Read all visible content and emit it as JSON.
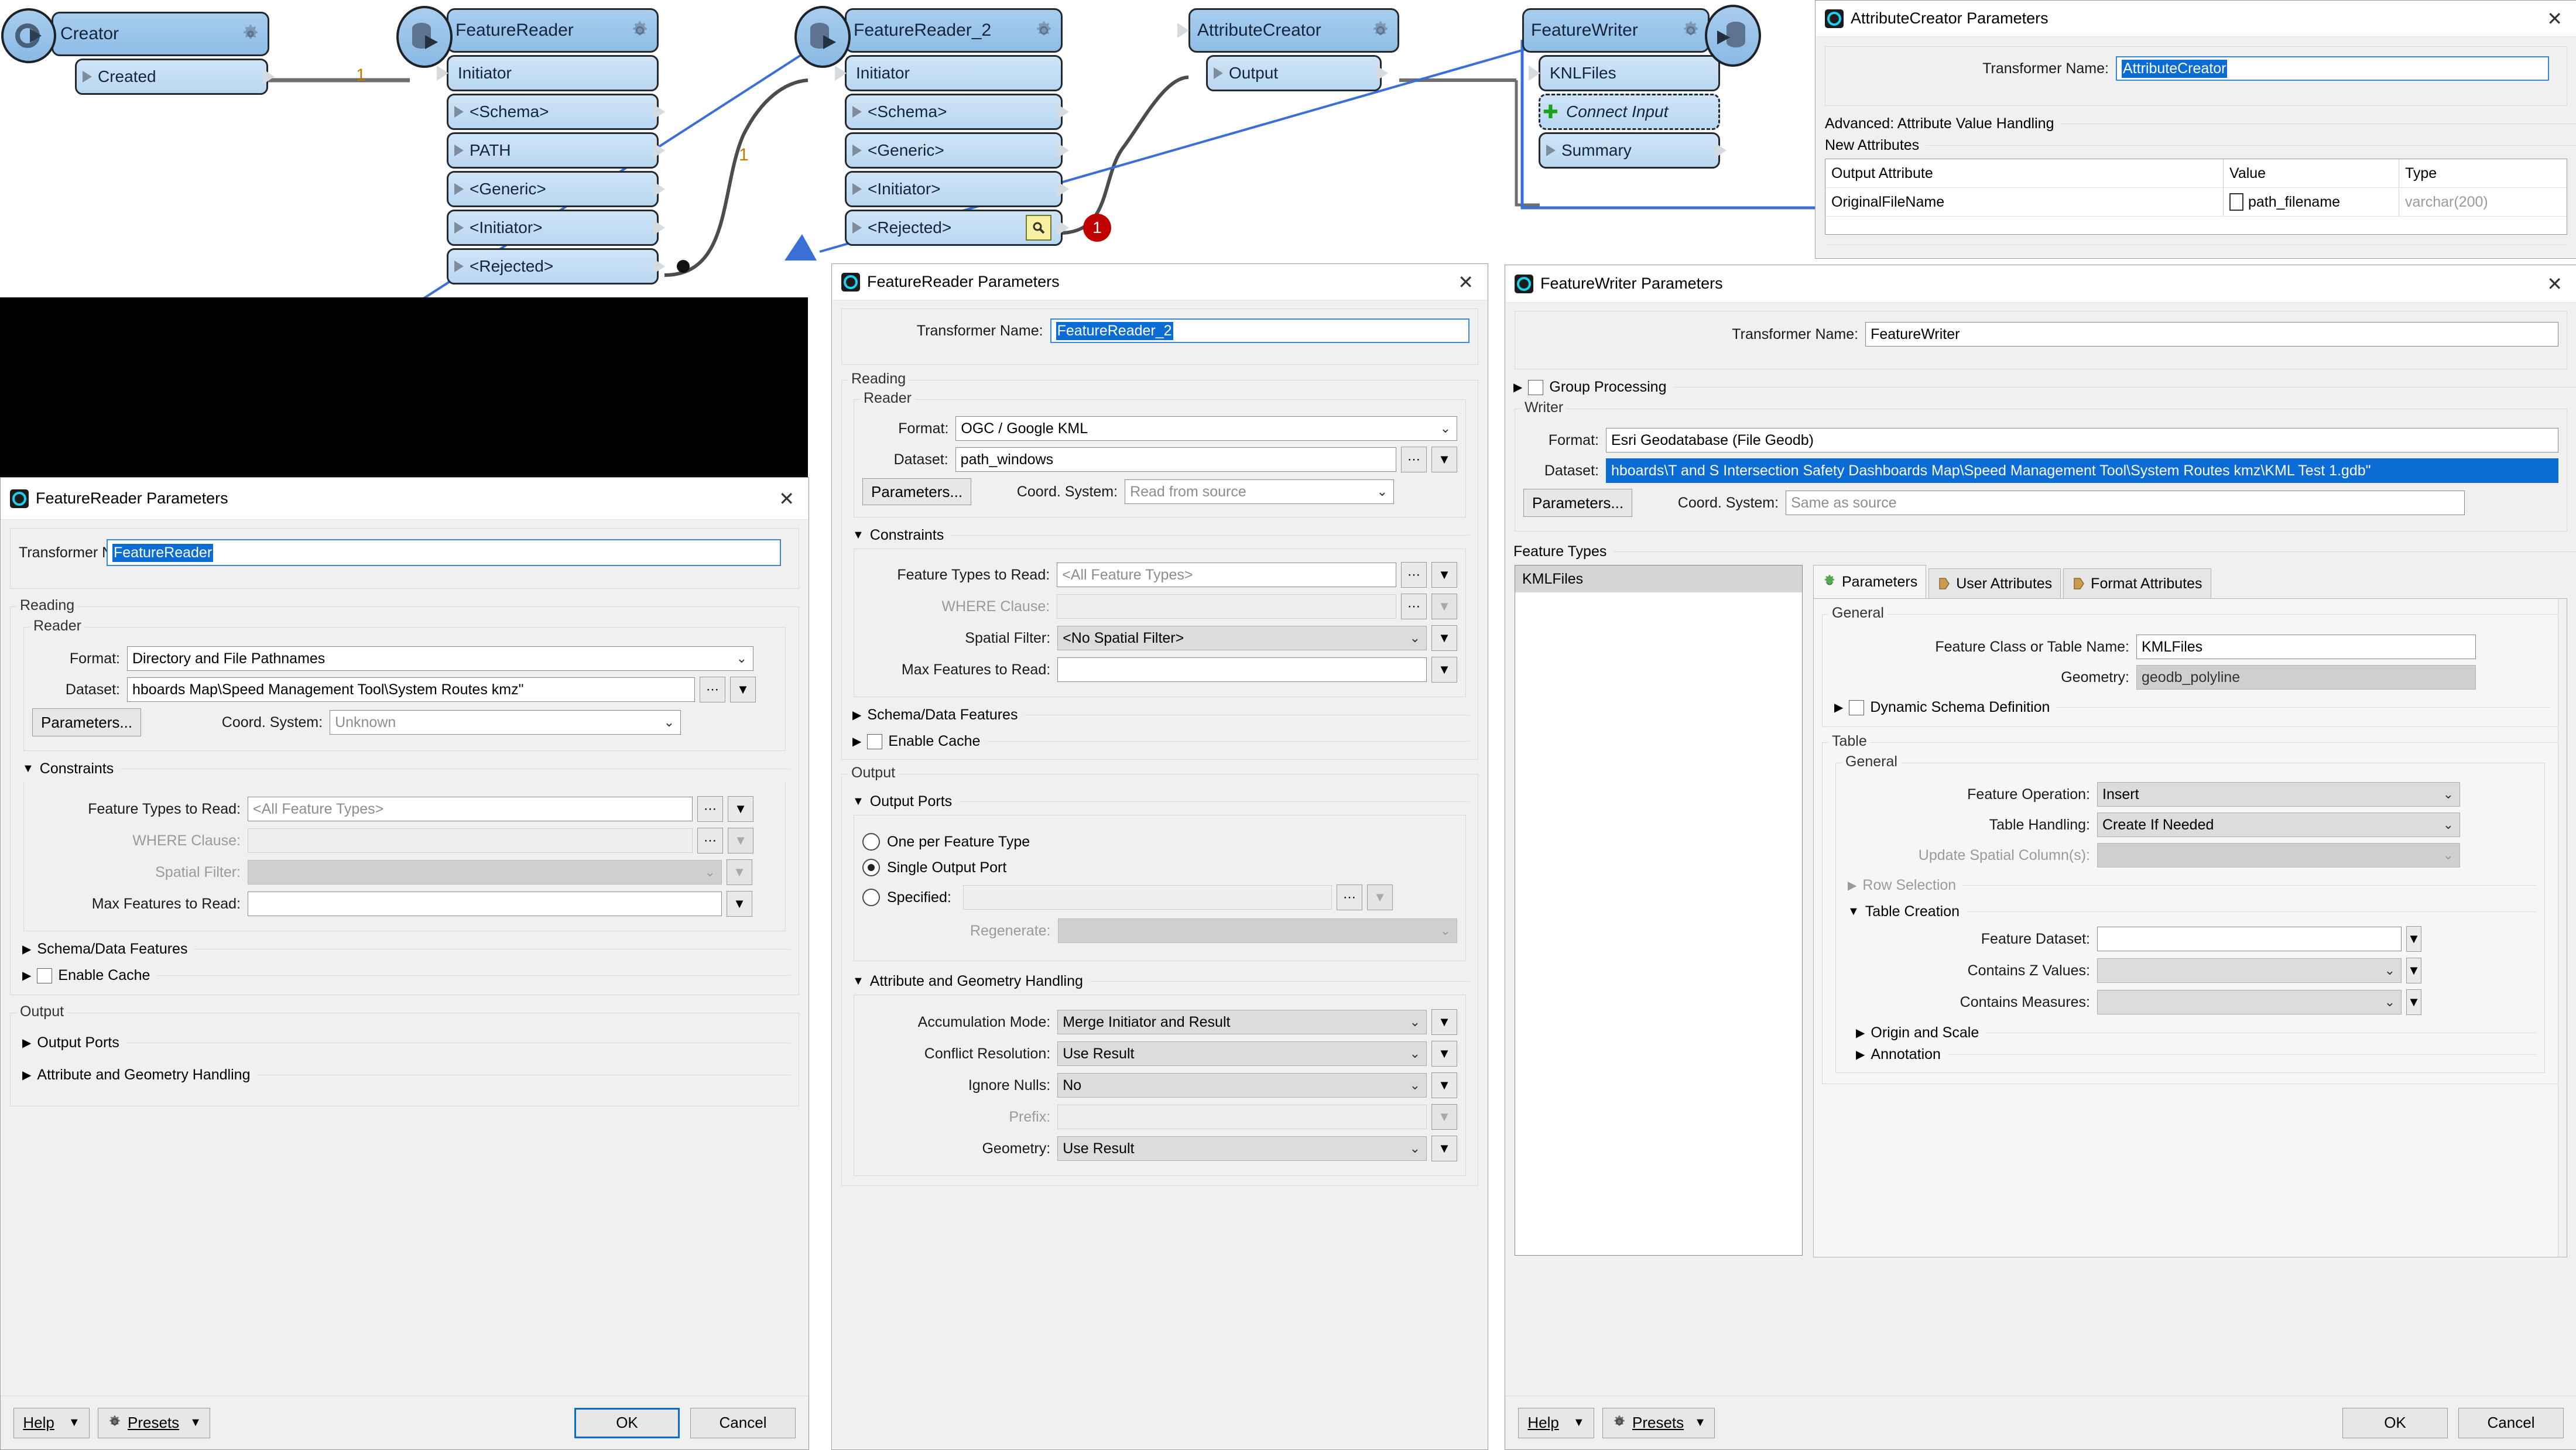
{
  "canvas": {
    "nodes": [
      {
        "name": "Creator",
        "ports": [
          {
            "label": "Created",
            "kind": "out"
          }
        ]
      },
      {
        "name": "FeatureReader",
        "ports": [
          {
            "label": "Initiator",
            "kind": "in"
          },
          {
            "label": "<Schema>",
            "kind": "out"
          },
          {
            "label": "PATH",
            "kind": "out"
          },
          {
            "label": "<Generic>",
            "kind": "out"
          },
          {
            "label": "<Initiator>",
            "kind": "out"
          },
          {
            "label": "<Rejected>",
            "kind": "out"
          }
        ]
      },
      {
        "name": "FeatureReader_2",
        "ports": [
          {
            "label": "Initiator",
            "kind": "in"
          },
          {
            "label": "<Schema>",
            "kind": "out"
          },
          {
            "label": "<Generic>",
            "kind": "out"
          },
          {
            "label": "<Initiator>",
            "kind": "out"
          },
          {
            "label": "<Rejected>",
            "kind": "out"
          }
        ]
      },
      {
        "name": "AttributeCreator",
        "ports": [
          {
            "label": "Output",
            "kind": "out"
          }
        ]
      },
      {
        "name": "FeatureWriter",
        "ports": [
          {
            "label": "KNLFiles",
            "kind": "in"
          },
          {
            "label": "Connect Input",
            "kind": "connect"
          },
          {
            "label": "Summary",
            "kind": "out"
          }
        ]
      }
    ],
    "connection_labels": [
      "1",
      "1"
    ],
    "rejected_badge_count": "1"
  },
  "attribute_creator": {
    "title": "AttributeCreator Parameters",
    "close_label": "✕",
    "transformer_name_label": "Transformer Name:",
    "transformer_name_value": "AttributeCreator",
    "advanced_section": "Advanced: Attribute Value Handling",
    "new_attributes_section": "New Attributes",
    "table": {
      "headers": [
        "Output Attribute",
        "Value",
        "Type"
      ],
      "rows": [
        [
          "OriginalFileName",
          "path_filename",
          "varchar(200)"
        ]
      ]
    }
  },
  "feature_reader": {
    "title": "FeatureReader Parameters",
    "close_label": "✕",
    "transformer_name_label": "Transformer Name:",
    "transformer_name_value": "FeatureReader",
    "reading_section": "Reading",
    "reader_section": "Reader",
    "format_label": "Format:",
    "format_value": "Directory and File Pathnames",
    "dataset_label": "Dataset:",
    "dataset_value": "hboards Map\\Speed Management Tool\\System Routes kmz\"",
    "parameters_button": "Parameters...",
    "coord_label": "Coord. System:",
    "coord_value": "Unknown",
    "constraints_section": "Constraints",
    "feature_types_label": "Feature Types to Read:",
    "feature_types_value": "<All Feature Types>",
    "where_label": "WHERE Clause:",
    "where_value": "",
    "spatial_label": "Spatial Filter:",
    "spatial_value": "",
    "max_features_label": "Max Features to Read:",
    "max_features_value": "",
    "schema_section": "Schema/Data Features",
    "enable_cache_label": "Enable Cache",
    "output_section": "Output",
    "output_ports_section": "Output Ports",
    "attr_geom_section": "Attribute and Geometry Handling",
    "help_button": "Help",
    "presets_button": "Presets",
    "ok_button": "OK",
    "cancel_button": "Cancel"
  },
  "feature_reader_2": {
    "title": "FeatureReader Parameters",
    "close_label": "✕",
    "transformer_name_label": "Transformer Name:",
    "transformer_name_value": "FeatureReader_2",
    "reading_section": "Reading",
    "reader_section": "Reader",
    "format_label": "Format:",
    "format_value": "OGC / Google KML",
    "dataset_label": "Dataset:",
    "dataset_value": "path_windows",
    "parameters_button": "Parameters...",
    "coord_label": "Coord. System:",
    "coord_value": "Read from source",
    "constraints_section": "Constraints",
    "feature_types_label": "Feature Types to Read:",
    "feature_types_value": "<All Feature Types>",
    "where_label": "WHERE Clause:",
    "where_value": "",
    "spatial_label": "Spatial Filter:",
    "spatial_value": "<No Spatial Filter>",
    "max_features_label": "Max Features to Read:",
    "max_features_value": "",
    "schema_section": "Schema/Data Features",
    "enable_cache_label": "Enable Cache",
    "output_section": "Output",
    "output_ports_section": "Output Ports",
    "radio_one_per": "One per Feature Type",
    "radio_single": "Single Output Port",
    "radio_specified": "Specified:",
    "specified_value": "",
    "regenerate_label": "Regenerate:",
    "regenerate_value": "",
    "attr_geom_section": "Attribute and Geometry Handling",
    "accumulation_label": "Accumulation Mode:",
    "accumulation_value": "Merge Initiator and Result",
    "conflict_label": "Conflict Resolution:",
    "conflict_value": "Use Result",
    "ignore_nulls_label": "Ignore Nulls:",
    "ignore_nulls_value": "No",
    "prefix_label": "Prefix:",
    "prefix_value": "",
    "geometry_label": "Geometry:",
    "geometry_value": "Use Result"
  },
  "feature_writer": {
    "title": "FeatureWriter Parameters",
    "close_label": "✕",
    "transformer_name_label": "Transformer Name:",
    "transformer_name_value": "FeatureWriter",
    "group_processing_label": "Group Processing",
    "writer_section": "Writer",
    "format_label": "Format:",
    "format_value": "Esri Geodatabase (File Geodb)",
    "dataset_label": "Dataset:",
    "dataset_value": "hboards\\T and S Intersection Safety Dashboards Map\\Speed Management Tool\\System Routes kmz\\KML Test 1.gdb\"",
    "parameters_button": "Parameters...",
    "coord_label": "Coord. System:",
    "coord_value": "Same as source",
    "feature_types_section": "Feature Types",
    "feature_types_list": [
      "KMLFiles"
    ],
    "tabs": [
      "Parameters",
      "User Attributes",
      "Format Attributes"
    ],
    "active_tab": "Parameters",
    "general_section": "General",
    "feature_class_label": "Feature Class or Table Name:",
    "feature_class_value": "KMLFiles",
    "geometry_label": "Geometry:",
    "geometry_value": "geodb_polyline",
    "dynamic_schema_label": "Dynamic Schema Definition",
    "table_section": "Table",
    "table_general_section": "General",
    "feature_operation_label": "Feature Operation:",
    "feature_operation_value": "Insert",
    "table_handling_label": "Table Handling:",
    "table_handling_value": "Create If Needed",
    "update_spatial_label": "Update Spatial Column(s):",
    "update_spatial_value": "",
    "row_selection_section": "Row Selection",
    "table_creation_section": "Table Creation",
    "feature_dataset_label": "Feature Dataset:",
    "feature_dataset_value": "",
    "contains_z_label": "Contains Z Values:",
    "contains_z_value": "",
    "contains_m_label": "Contains Measures:",
    "contains_m_value": "",
    "origin_scale_section": "Origin and Scale",
    "annotation_section": "Annotation",
    "help_button": "Help",
    "presets_button": "Presets",
    "ok_button": "OK",
    "cancel_button": "Cancel"
  }
}
